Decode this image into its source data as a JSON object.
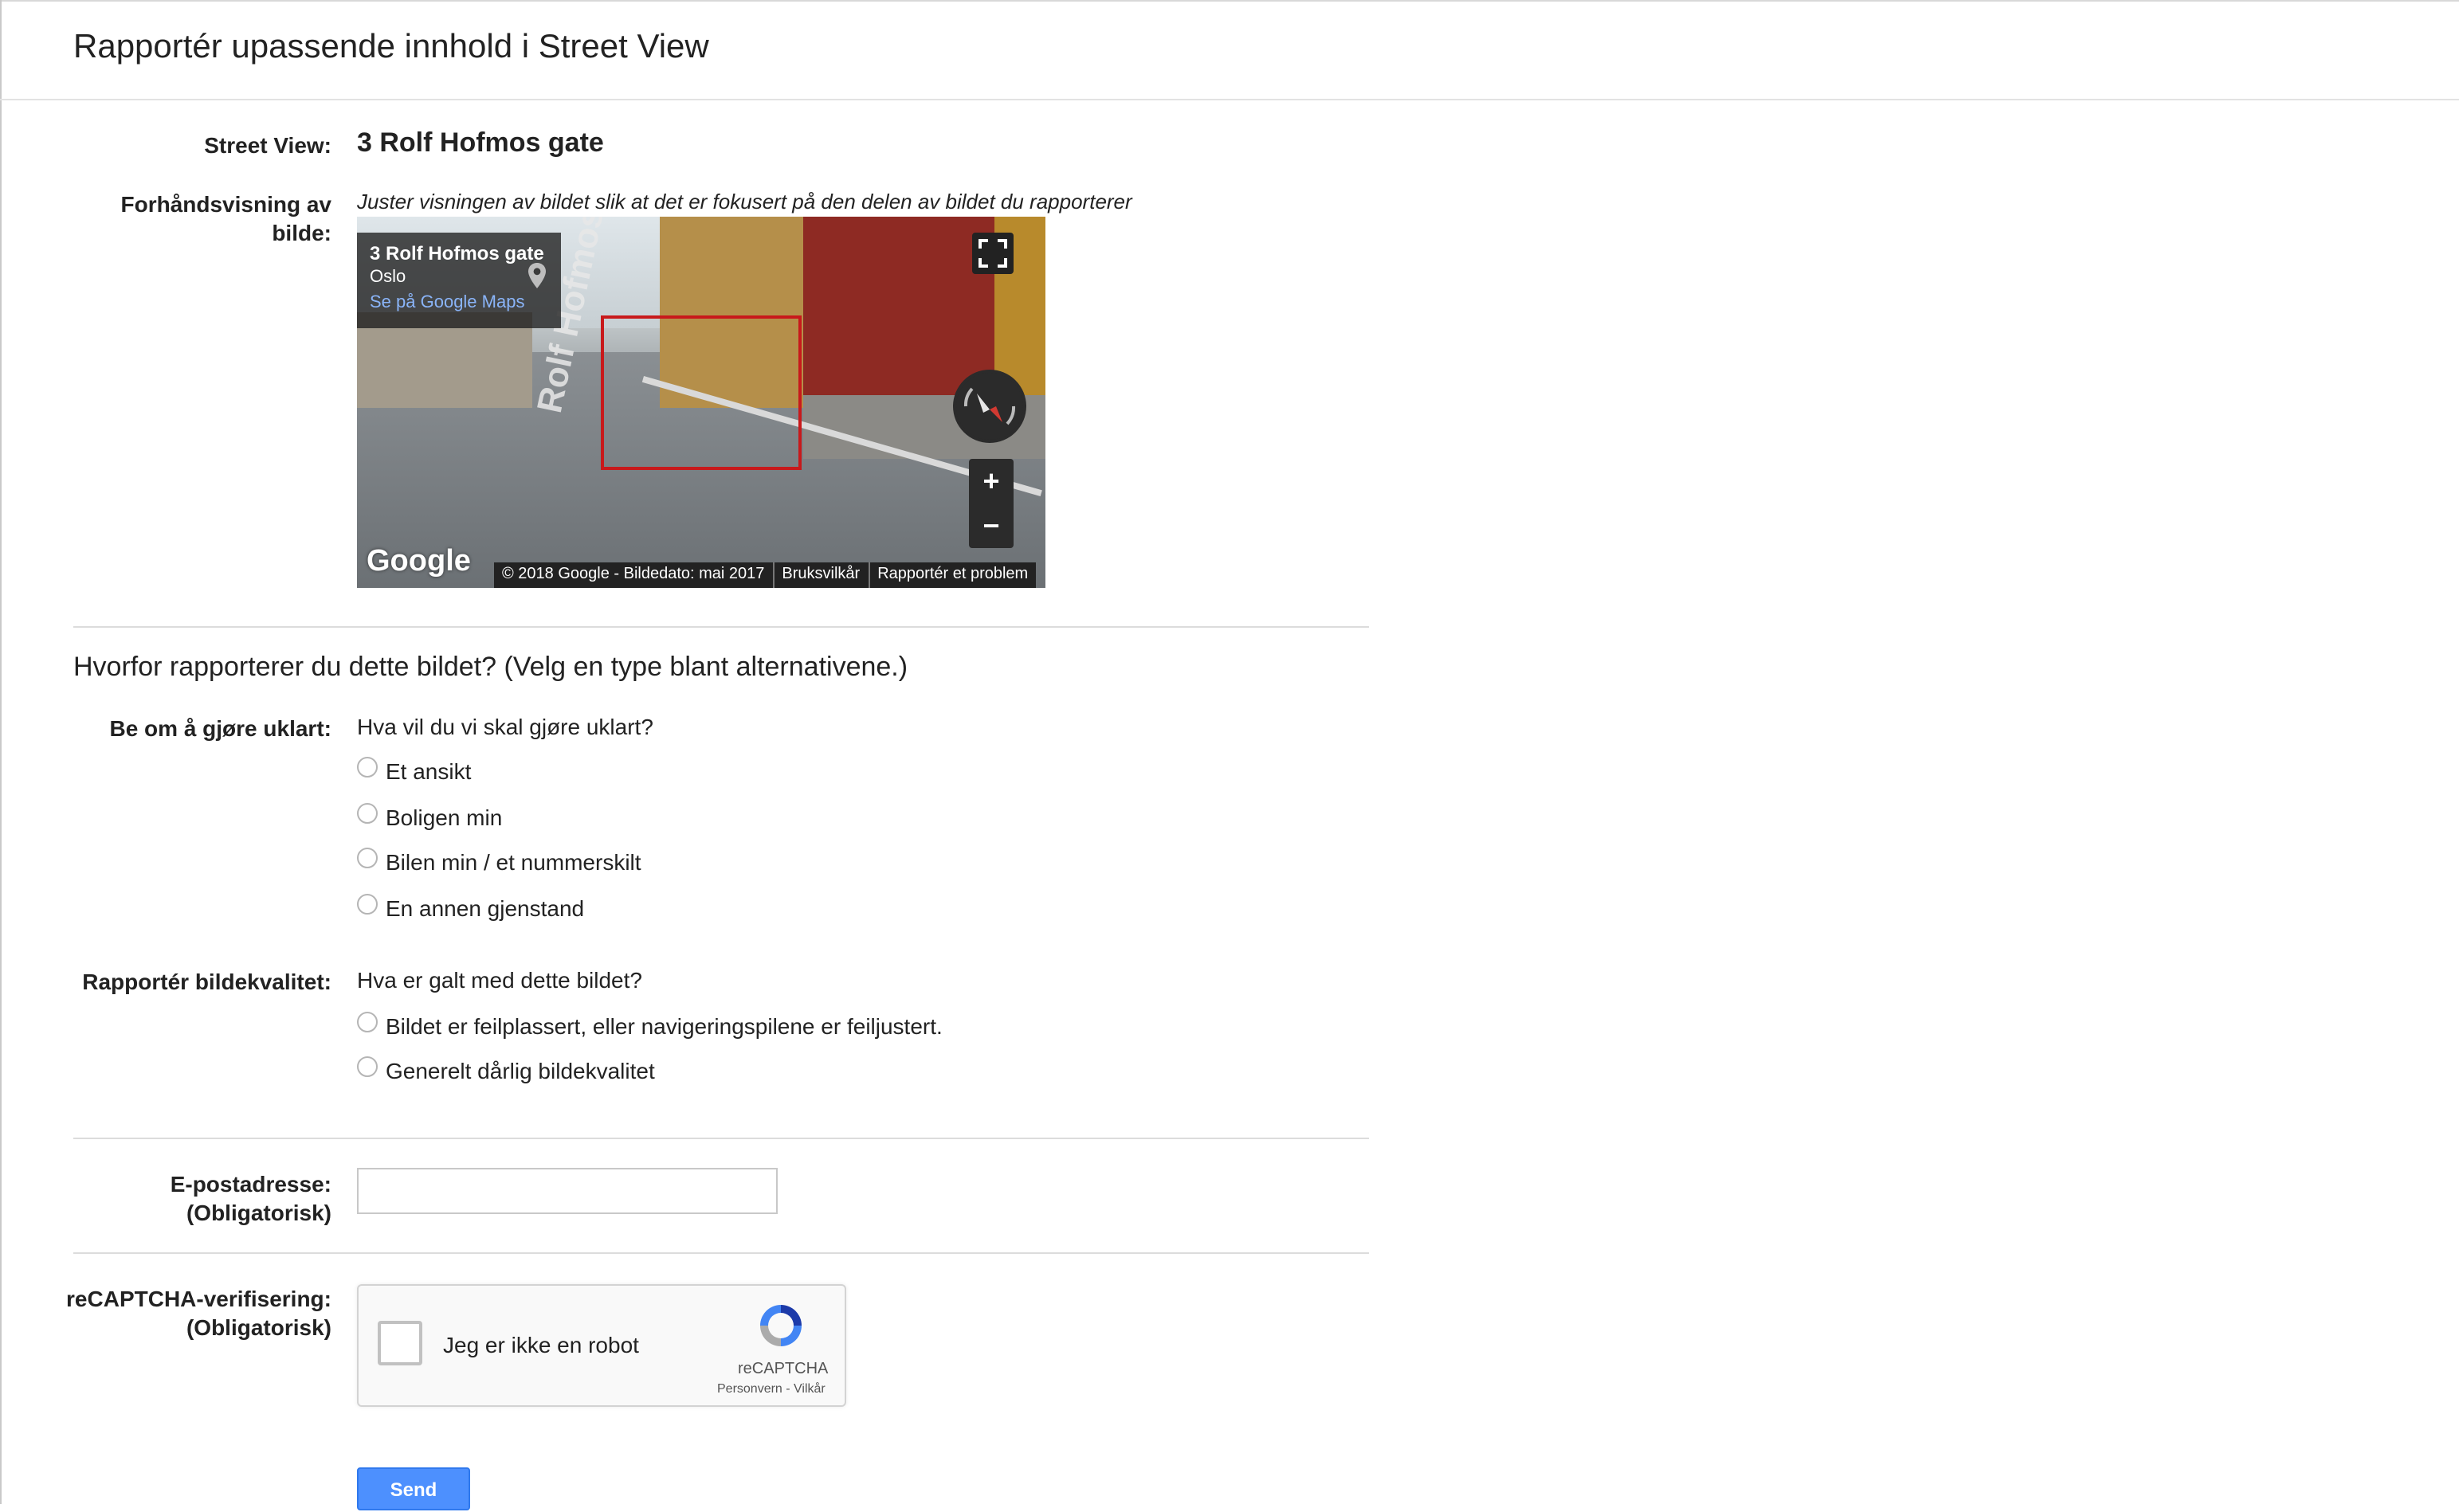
{
  "header": {
    "title": "Rapportér upassende innhold i Street View"
  },
  "streetview": {
    "label": "Street View:",
    "value": "3 Rolf Hofmos gate"
  },
  "preview": {
    "label_line1": "Forhåndsvisning av",
    "label_line2": "bilde:",
    "hint": "Juster visningen av bildet slik at det er fokusert på den delen av bildet du rapporterer",
    "info_title": "3 Rolf Hofmos gate",
    "info_city": "Oslo",
    "info_link": "Se på Google Maps",
    "road_text": "Rolf Hofmos",
    "google_logo": "Google",
    "footer_copyright": "© 2018 Google - Bildedato: mai 2017",
    "footer_terms": "Bruksvilkår",
    "footer_report": "Rapportér et problem",
    "zoom_in": "+",
    "zoom_out": "−"
  },
  "reason": {
    "title": "Hvorfor rapporterer du dette bildet?  (Velg en type blant alternativene.)",
    "blur": {
      "label": "Be om å gjøre uklart:",
      "question": "Hva vil du vi skal gjøre uklart?",
      "options": [
        "Et ansikt",
        "Boligen min",
        "Bilen min / et nummerskilt",
        "En annen gjenstand"
      ]
    },
    "quality": {
      "label": "Rapportér bildekvalitet:",
      "question": "Hva er galt med dette bildet?",
      "options": [
        "Bildet er feilplassert, eller navigeringspilene er feiljustert.",
        "Generelt dårlig bildekvalitet"
      ]
    }
  },
  "email": {
    "label_line1": "E-postadresse:",
    "label_line2": "(Obligatorisk)",
    "value": ""
  },
  "captcha": {
    "label_line1": "reCAPTCHA-verifisering:",
    "label_line2": "(Obligatorisk)",
    "checkbox_text": "Jeg er ikke en robot",
    "brand": "reCAPTCHA",
    "terms": "Personvern - Vilkår"
  },
  "submit": {
    "label": "Send"
  },
  "colors": {
    "button_blue": "#4d90fe",
    "highlight_red": "#c8191b",
    "link_blue": "#8ab4f8"
  },
  "icons": [
    "map-pin-icon",
    "fullscreen-icon",
    "compass-icon",
    "recaptcha-logo-icon"
  ]
}
